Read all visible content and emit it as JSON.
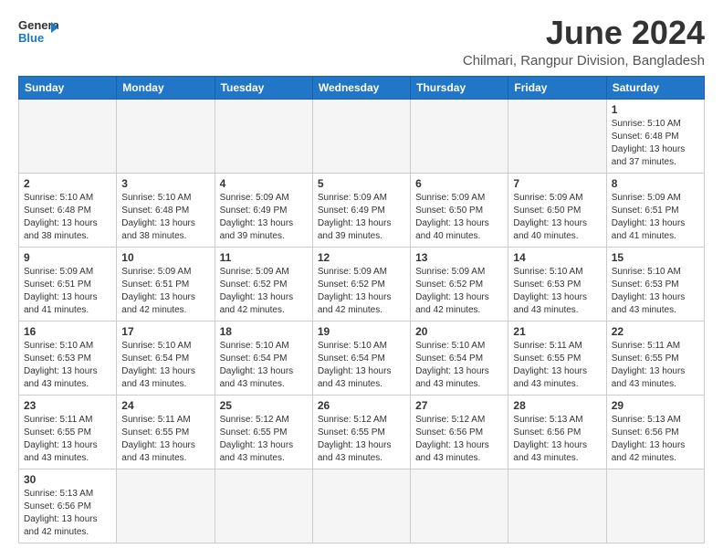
{
  "header": {
    "logo_line1": "General",
    "logo_line2": "Blue",
    "title": "June 2024",
    "subtitle": "Chilmari, Rangpur Division, Bangladesh"
  },
  "calendar": {
    "days_of_week": [
      "Sunday",
      "Monday",
      "Tuesday",
      "Wednesday",
      "Thursday",
      "Friday",
      "Saturday"
    ],
    "weeks": [
      [
        {
          "day": "",
          "info": ""
        },
        {
          "day": "",
          "info": ""
        },
        {
          "day": "",
          "info": ""
        },
        {
          "day": "",
          "info": ""
        },
        {
          "day": "",
          "info": ""
        },
        {
          "day": "",
          "info": ""
        },
        {
          "day": "1",
          "info": "Sunrise: 5:10 AM\nSunset: 6:48 PM\nDaylight: 13 hours\nand 37 minutes."
        }
      ],
      [
        {
          "day": "2",
          "info": "Sunrise: 5:10 AM\nSunset: 6:48 PM\nDaylight: 13 hours\nand 38 minutes."
        },
        {
          "day": "3",
          "info": "Sunrise: 5:10 AM\nSunset: 6:48 PM\nDaylight: 13 hours\nand 38 minutes."
        },
        {
          "day": "4",
          "info": "Sunrise: 5:09 AM\nSunset: 6:49 PM\nDaylight: 13 hours\nand 39 minutes."
        },
        {
          "day": "5",
          "info": "Sunrise: 5:09 AM\nSunset: 6:49 PM\nDaylight: 13 hours\nand 39 minutes."
        },
        {
          "day": "6",
          "info": "Sunrise: 5:09 AM\nSunset: 6:50 PM\nDaylight: 13 hours\nand 40 minutes."
        },
        {
          "day": "7",
          "info": "Sunrise: 5:09 AM\nSunset: 6:50 PM\nDaylight: 13 hours\nand 40 minutes."
        },
        {
          "day": "8",
          "info": "Sunrise: 5:09 AM\nSunset: 6:51 PM\nDaylight: 13 hours\nand 41 minutes."
        }
      ],
      [
        {
          "day": "9",
          "info": "Sunrise: 5:09 AM\nSunset: 6:51 PM\nDaylight: 13 hours\nand 41 minutes."
        },
        {
          "day": "10",
          "info": "Sunrise: 5:09 AM\nSunset: 6:51 PM\nDaylight: 13 hours\nand 42 minutes."
        },
        {
          "day": "11",
          "info": "Sunrise: 5:09 AM\nSunset: 6:52 PM\nDaylight: 13 hours\nand 42 minutes."
        },
        {
          "day": "12",
          "info": "Sunrise: 5:09 AM\nSunset: 6:52 PM\nDaylight: 13 hours\nand 42 minutes."
        },
        {
          "day": "13",
          "info": "Sunrise: 5:09 AM\nSunset: 6:52 PM\nDaylight: 13 hours\nand 42 minutes."
        },
        {
          "day": "14",
          "info": "Sunrise: 5:10 AM\nSunset: 6:53 PM\nDaylight: 13 hours\nand 43 minutes."
        },
        {
          "day": "15",
          "info": "Sunrise: 5:10 AM\nSunset: 6:53 PM\nDaylight: 13 hours\nand 43 minutes."
        }
      ],
      [
        {
          "day": "16",
          "info": "Sunrise: 5:10 AM\nSunset: 6:53 PM\nDaylight: 13 hours\nand 43 minutes."
        },
        {
          "day": "17",
          "info": "Sunrise: 5:10 AM\nSunset: 6:54 PM\nDaylight: 13 hours\nand 43 minutes."
        },
        {
          "day": "18",
          "info": "Sunrise: 5:10 AM\nSunset: 6:54 PM\nDaylight: 13 hours\nand 43 minutes."
        },
        {
          "day": "19",
          "info": "Sunrise: 5:10 AM\nSunset: 6:54 PM\nDaylight: 13 hours\nand 43 minutes."
        },
        {
          "day": "20",
          "info": "Sunrise: 5:10 AM\nSunset: 6:54 PM\nDaylight: 13 hours\nand 43 minutes."
        },
        {
          "day": "21",
          "info": "Sunrise: 5:11 AM\nSunset: 6:55 PM\nDaylight: 13 hours\nand 43 minutes."
        },
        {
          "day": "22",
          "info": "Sunrise: 5:11 AM\nSunset: 6:55 PM\nDaylight: 13 hours\nand 43 minutes."
        }
      ],
      [
        {
          "day": "23",
          "info": "Sunrise: 5:11 AM\nSunset: 6:55 PM\nDaylight: 13 hours\nand 43 minutes."
        },
        {
          "day": "24",
          "info": "Sunrise: 5:11 AM\nSunset: 6:55 PM\nDaylight: 13 hours\nand 43 minutes."
        },
        {
          "day": "25",
          "info": "Sunrise: 5:12 AM\nSunset: 6:55 PM\nDaylight: 13 hours\nand 43 minutes."
        },
        {
          "day": "26",
          "info": "Sunrise: 5:12 AM\nSunset: 6:55 PM\nDaylight: 13 hours\nand 43 minutes."
        },
        {
          "day": "27",
          "info": "Sunrise: 5:12 AM\nSunset: 6:56 PM\nDaylight: 13 hours\nand 43 minutes."
        },
        {
          "day": "28",
          "info": "Sunrise: 5:13 AM\nSunset: 6:56 PM\nDaylight: 13 hours\nand 43 minutes."
        },
        {
          "day": "29",
          "info": "Sunrise: 5:13 AM\nSunset: 6:56 PM\nDaylight: 13 hours\nand 42 minutes."
        }
      ],
      [
        {
          "day": "30",
          "info": "Sunrise: 5:13 AM\nSunset: 6:56 PM\nDaylight: 13 hours\nand 42 minutes."
        },
        {
          "day": "",
          "info": ""
        },
        {
          "day": "",
          "info": ""
        },
        {
          "day": "",
          "info": ""
        },
        {
          "day": "",
          "info": ""
        },
        {
          "day": "",
          "info": ""
        },
        {
          "day": "",
          "info": ""
        }
      ]
    ]
  }
}
